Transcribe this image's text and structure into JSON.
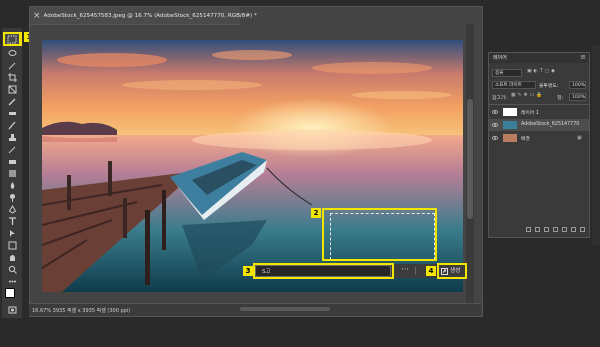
{
  "document": {
    "tab_title": "AdobeStock_625457583.jpeg @ 16.7% (AdobeStock_625147770, RGB/8#) *",
    "status": "16.67%    3935 픽셀 x 3935 픽셀 (300 ppi)"
  },
  "taskbar": {
    "prompt_value": "S고",
    "more_label": "···",
    "generate_label": "생성"
  },
  "callouts": [
    "1",
    "2",
    "3",
    "4"
  ],
  "layers_panel": {
    "tab_label": "레이어",
    "menu_label": "≡",
    "filter_label": "종류",
    "blend_mode": "소프트 라이트",
    "opacity_label": "불투명도:",
    "opacity_value": "100%",
    "lock_label": "잠그기:",
    "fill_label": "칠:",
    "fill_value": "100%",
    "layers": [
      {
        "name": "레이어 1"
      },
      {
        "name": "AdobeStock_625147770"
      },
      {
        "name": "배경"
      }
    ]
  },
  "colors": {
    "highlight": "#f2e600",
    "background": "#2a2a2a",
    "panel": "#3a3a3a"
  }
}
